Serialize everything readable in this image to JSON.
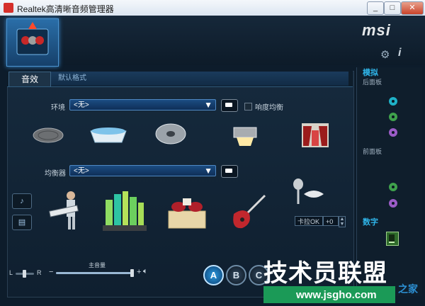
{
  "window": {
    "title": "Realtek高清晰音频管理器",
    "minimize_icon": "minimize-icon",
    "maximize_icon": "maximize-icon",
    "close_icon": "close-icon"
  },
  "header": {
    "brand": "msi",
    "device_icon": "speaker-jacks-icon",
    "settings_icon": "gear-icon",
    "info_icon": "info-icon",
    "info_label": "i"
  },
  "tabs": {
    "active": "音效",
    "secondary": "默认格式"
  },
  "environment": {
    "label": "环境",
    "value": "<无>",
    "loudness_label": "响度均衡",
    "loudness_checked": false
  },
  "environment_icons": [
    "manhole-cover-icon",
    "bathtub-icon",
    "cd-disc-icon",
    "stage-spotlight-icon",
    "theater-curtain-icon"
  ],
  "equalizer": {
    "label": "均衡器",
    "value": "<无>"
  },
  "equalizer_icons": [
    "keytar-player-icon",
    "city-skyline-icon",
    "stage-speakers-icon",
    "electric-guitar-icon",
    "microphone-lips-icon"
  ],
  "side_buttons": {
    "guitar_icon": "guitar-icon",
    "keyboard_icon": "keyboard-icon"
  },
  "karaoke": {
    "label": "卡拉OK",
    "value": "+0",
    "up_icon": "chevron-up-icon",
    "down_icon": "chevron-down-icon"
  },
  "volume": {
    "main_label": "主音量",
    "left": "L",
    "right": "R",
    "balance": 0.5,
    "level": 0.98,
    "minus": "−",
    "plus": "+",
    "speaker_icon": "speaker-icon"
  },
  "profiles": [
    "A",
    "B",
    "C"
  ],
  "side_panel": {
    "analog": "模拟",
    "rear_panel": "后面板",
    "front_panel": "前面板",
    "digital": "数字",
    "digital_icon": "spdif-icon"
  },
  "rear_jacks": [
    "#1fb1c7",
    "#3fa14c",
    "#9b5cc7"
  ],
  "front_jacks": [
    "#3fa14c",
    "#9b5cc7"
  ],
  "watermark": {
    "main": "技术员联盟",
    "url": "www.jsgho.com",
    "tail": "之家"
  }
}
